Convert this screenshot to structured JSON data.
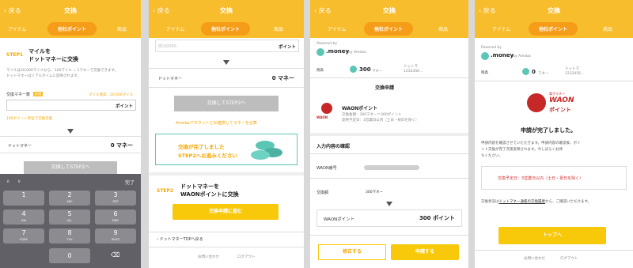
{
  "header": {
    "back": "戻る",
    "title": "交換"
  },
  "tabs": {
    "item": "アイテム",
    "points": "他社ポイント",
    "goods": "商品"
  },
  "p1": {
    "step_label": "STEP1",
    "step_title_1": "マイルを",
    "step_title_2": "ドットマネーに交換",
    "desc": "マイルは20,000マイルから、100マイル = 1マネーで交換できます。",
    "desc2": "ドットマネーはリアルタイムに反映されます。",
    "exchange_label": "交換マネー数",
    "badge": "必須",
    "limit": "マイル残高：20,000マイル",
    "point_unit": "ポイント",
    "note": "100ポイント単位で交換可能",
    "dm_label": "ドットマネー",
    "dm_value": "0 マネー",
    "btn": "交換してSTEP2へ",
    "kbd_done": "完了",
    "keys": [
      {
        "n": "1",
        "s": ""
      },
      {
        "n": "2",
        "s": "ABC"
      },
      {
        "n": "3",
        "s": "DEF"
      },
      {
        "n": "4",
        "s": "GHI"
      },
      {
        "n": "5",
        "s": "JKL"
      },
      {
        "n": "6",
        "s": "MNO"
      },
      {
        "n": "7",
        "s": "PQRS"
      },
      {
        "n": "8",
        "s": "TUV"
      },
      {
        "n": "9",
        "s": "WXYZ"
      },
      {
        "n": "0",
        "s": ""
      }
    ],
    "kbd_delete": "⌫"
  },
  "p2": {
    "placeholder": "例)30000",
    "point_unit": "ポイント",
    "dm_label": "ドットマネー",
    "dm_value": "0 マネー",
    "btn": "交換してSTEP2へ",
    "link": "AmebaアカウントとID連携してマネーを合算",
    "banner_1": "交換が完了しました",
    "banner_2": "STEP2へお進みください",
    "step_label": "STEP2",
    "step_title_1": "ドットマネーを",
    "step_title_2": "WAONポイントに交換",
    "btn2": "交換申請に進む",
    "back_link": "ドットマネーTOPへ戻る",
    "footer_1": "お問い合わせ",
    "footer_2": "ログアウト"
  },
  "p3": {
    "powered": "Powered by",
    "brand": ".money",
    "brand_sub": "by Ameba",
    "balance_label": "残高",
    "balance": "300",
    "balance_unit": "マネー",
    "side_1": "ドットマ",
    "side_2": "1232456...",
    "section": "交換申請",
    "waon_title": "WAONポイント",
    "waon_1": "交換金額：300マネー＝300ポイント",
    "waon_2": "反映予定日：3営業日以内（土日・祝日を除く）",
    "confirm_title": "入力内容の確認",
    "waon_no_label": "WAON番号",
    "amount_label": "交換額",
    "amount_value": "300マネー",
    "result_label": "WAONポイント",
    "result_value": "300 ポイント",
    "btn_fix": "修正する",
    "btn_apply": "申請する"
  },
  "p4": {
    "powered": "Powered by",
    "brand": ".money",
    "brand_sub": "by Ameba",
    "balance_label": "残高",
    "balance": "0",
    "balance_unit": "マネー",
    "side_1": "ドットマ",
    "side_2": "1232456...",
    "logo_text_1": "電子マネー",
    "logo_text_2": "WAON",
    "logo_text_3": "ポイント",
    "done": "申請が完了しました。",
    "desc_1": "申請内容を確認させていただきます。申請内容の確認後、ポイ",
    "desc_2": "ント交換が完了次第反映されます。今しばらくお待",
    "desc_3": "ちください。",
    "schedule": "交換予定日：3営業日以内（土日・祝日を除く）",
    "status_1": "交換状況は",
    "status_link": "ドットマネー通帳の交換履歴",
    "status_2": "から、ご確認いただけます。",
    "btn": "トップへ",
    "footer_1": "お問い合わせ",
    "footer_2": "ログアウト"
  }
}
